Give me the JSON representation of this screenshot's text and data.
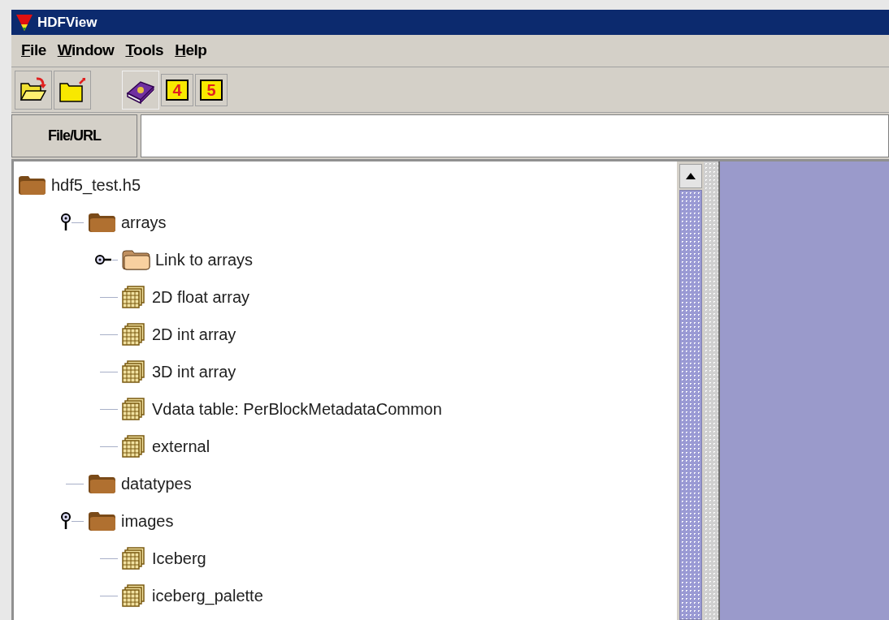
{
  "window": {
    "title": "HDFView"
  },
  "menu": [
    {
      "label": "File"
    },
    {
      "label": "Window"
    },
    {
      "label": "Tools"
    },
    {
      "label": "Help"
    }
  ],
  "toolbar": [
    {
      "kind": "open"
    },
    {
      "kind": "close"
    },
    {
      "kind": "help"
    },
    {
      "kind": "numbered",
      "label": "4"
    },
    {
      "kind": "numbered",
      "label": "5"
    }
  ],
  "url_bar": {
    "button": "File/URL"
  },
  "tree": {
    "label": "hdf5_test.h5",
    "kind": "file",
    "children": [
      {
        "label": "arrays",
        "kind": "group",
        "expanded": true,
        "children": [
          {
            "label": "Link to arrays",
            "kind": "link",
            "expanded": false
          },
          {
            "label": "2D float array",
            "kind": "dataset"
          },
          {
            "label": "2D int array",
            "kind": "dataset"
          },
          {
            "label": "3D int array",
            "kind": "dataset"
          },
          {
            "label": "Vdata table: PerBlockMetadataCommon",
            "kind": "dataset"
          },
          {
            "label": "external",
            "kind": "dataset"
          }
        ]
      },
      {
        "label": "datatypes",
        "kind": "group"
      },
      {
        "label": "images",
        "kind": "group",
        "expanded": true,
        "children": [
          {
            "label": "Iceberg",
            "kind": "dataset"
          },
          {
            "label": "iceberg_palette",
            "kind": "dataset"
          }
        ]
      }
    ]
  }
}
